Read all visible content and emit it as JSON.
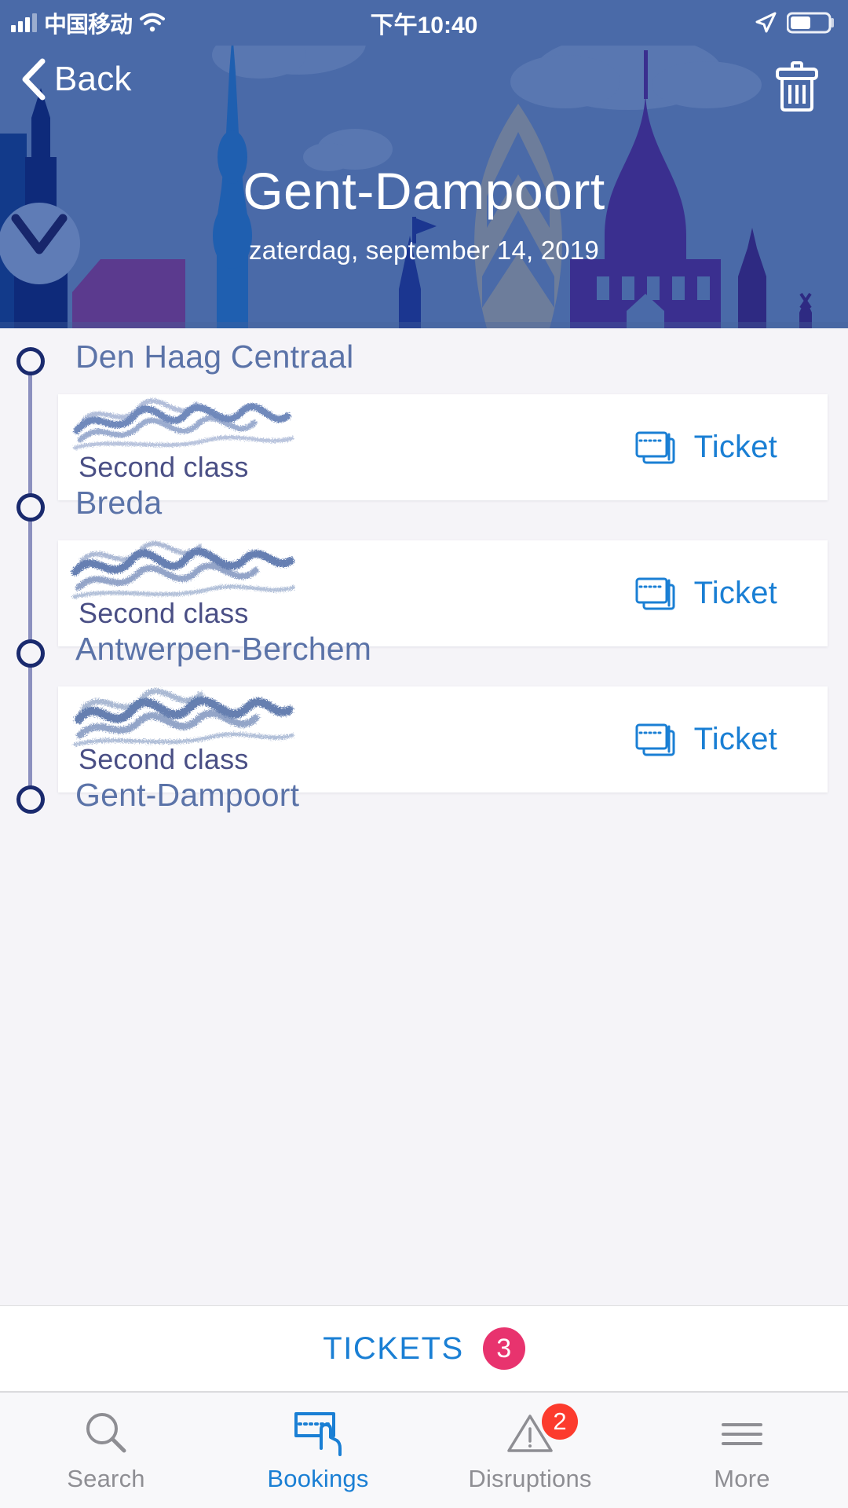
{
  "status_bar": {
    "carrier": "中国移动",
    "time": "下午10:40",
    "signal_icon": "signal-bars-icon",
    "wifi_icon": "wifi-icon",
    "location_icon": "location-arrow-icon",
    "battery_icon": "battery-icon"
  },
  "header": {
    "back_label": "Back",
    "back_icon": "chevron-left-icon",
    "delete_icon": "trash-icon",
    "title": "Gent-Dampoort",
    "subtitle": "zaterdag, september 14, 2019",
    "background_color": "#4a6aa8"
  },
  "journey": {
    "stops": [
      {
        "name": "Den Haag Centraal",
        "ticket": {
          "passenger_redacted": true,
          "class_label": "Second class",
          "link_label": "Ticket",
          "link_icon": "ticket-stack-icon"
        }
      },
      {
        "name": "Breda",
        "ticket": {
          "passenger_redacted": true,
          "class_label": "Second class",
          "link_label": "Ticket",
          "link_icon": "ticket-stack-icon"
        }
      },
      {
        "name": "Antwerpen-Berchem",
        "ticket": {
          "passenger_redacted": true,
          "class_label": "Second class",
          "link_label": "Ticket",
          "link_icon": "ticket-stack-icon"
        }
      },
      {
        "name": "Gent-Dampoort",
        "ticket": null
      }
    ],
    "stop_name_color": "#5b73a8",
    "timeline_dot_color": "#1a2a6e",
    "timeline_line_color": "#8c90bf"
  },
  "tickets_bar": {
    "label": "TICKETS",
    "count": "3",
    "badge_color": "#e8336e",
    "label_color": "#1a7fd4"
  },
  "tab_bar": {
    "tabs": [
      {
        "label": "Search",
        "icon": "search-icon",
        "active": false,
        "badge": null
      },
      {
        "label": "Bookings",
        "icon": "ticket-hand-icon",
        "active": true,
        "badge": null
      },
      {
        "label": "Disruptions",
        "icon": "warning-triangle-icon",
        "active": false,
        "badge": "2"
      },
      {
        "label": "More",
        "icon": "hamburger-menu-icon",
        "active": false,
        "badge": null
      }
    ],
    "active_color": "#1a7fd4",
    "inactive_color": "#8e8e93",
    "badge_color": "#fc3b2d"
  }
}
